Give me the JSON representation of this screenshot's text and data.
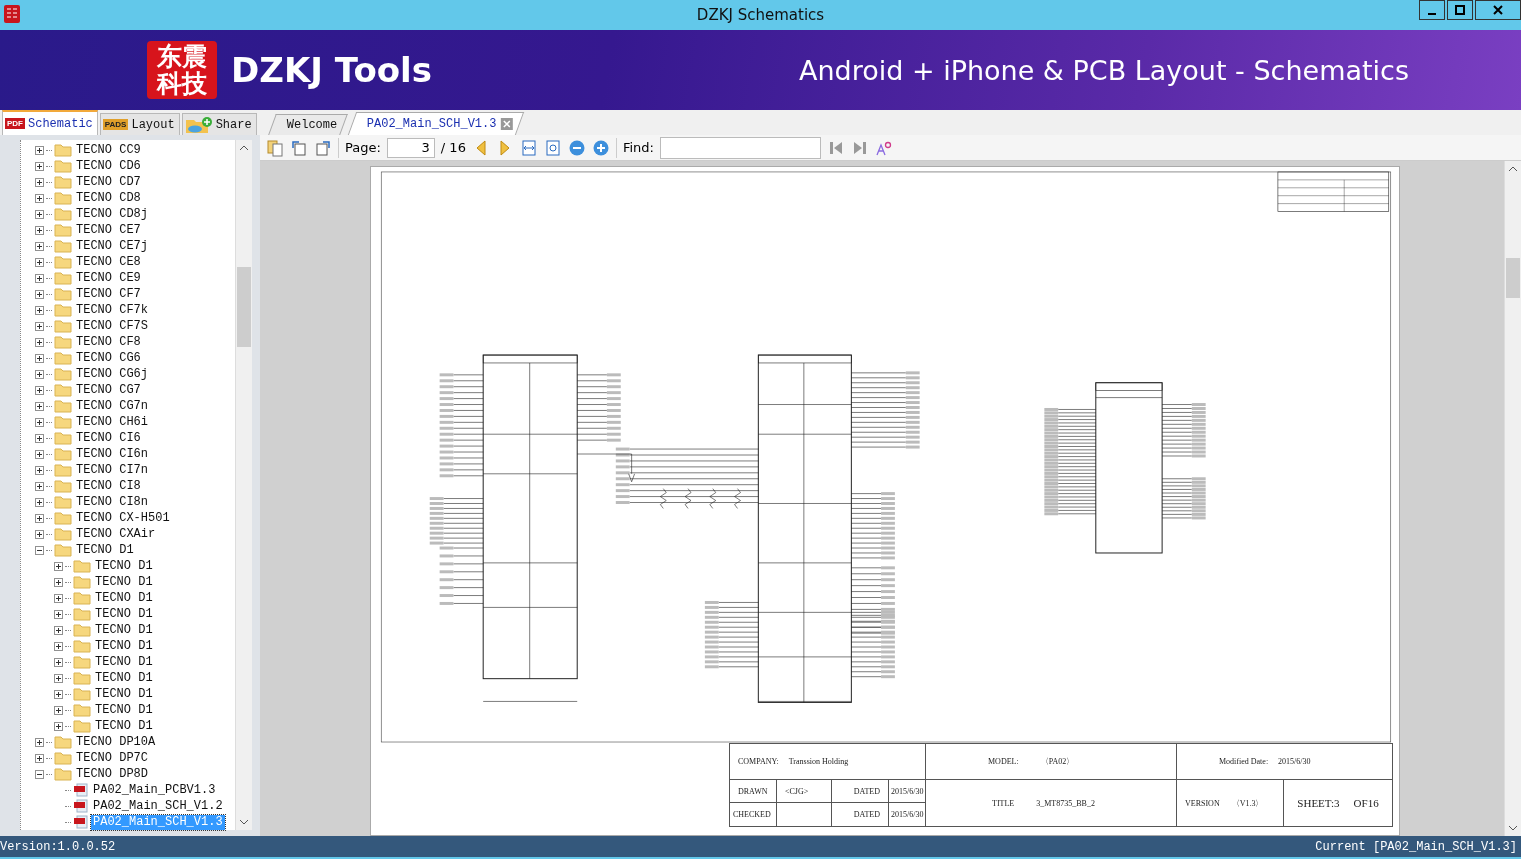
{
  "window": {
    "title": "DZKJ Schematics"
  },
  "banner": {
    "logo_lines": [
      "东震",
      "科技"
    ],
    "title": "DZKJ Tools",
    "tagline": "Android + iPhone & PCB Layout - Schematics"
  },
  "side_tabs": [
    {
      "label": "Schematic",
      "badge": "PDF",
      "selected": true
    },
    {
      "label": "Layout",
      "badge": "PADS",
      "selected": false
    },
    {
      "label": "Share",
      "selected": false
    }
  ],
  "doc_tabs": [
    {
      "label": "Welcome",
      "selected": false,
      "closable": false
    },
    {
      "label": "PA02_Main_SCH_V1.3",
      "selected": true,
      "closable": true
    }
  ],
  "toolbar": {
    "page_label": "Page:",
    "page_value": "3",
    "page_total": "/ 16",
    "find_label": "Find:"
  },
  "tree": [
    {
      "label": "TECNO CC9",
      "kind": "folder",
      "expanded": false,
      "selected": false
    },
    {
      "label": "TECNO CD6",
      "kind": "folder",
      "expanded": false,
      "selected": false
    },
    {
      "label": "TECNO CD7",
      "kind": "folder",
      "expanded": false,
      "selected": false
    },
    {
      "label": "TECNO CD8",
      "kind": "folder",
      "expanded": false,
      "selected": false
    },
    {
      "label": "TECNO CD8j",
      "kind": "folder",
      "expanded": false,
      "selected": false
    },
    {
      "label": "TECNO CE7",
      "kind": "folder",
      "expanded": false,
      "selected": false
    },
    {
      "label": "TECNO CE7j",
      "kind": "folder",
      "expanded": false,
      "selected": false
    },
    {
      "label": "TECNO CE8",
      "kind": "folder",
      "expanded": false,
      "selected": false
    },
    {
      "label": "TECNO CE9",
      "kind": "folder",
      "expanded": false,
      "selected": false
    },
    {
      "label": "TECNO CF7",
      "kind": "folder",
      "expanded": false,
      "selected": false
    },
    {
      "label": "TECNO CF7k",
      "kind": "folder",
      "expanded": false,
      "selected": false
    },
    {
      "label": "TECNO CF7S",
      "kind": "folder",
      "expanded": false,
      "selected": false
    },
    {
      "label": "TECNO CF8",
      "kind": "folder",
      "expanded": false,
      "selected": false
    },
    {
      "label": "TECNO CG6",
      "kind": "folder",
      "expanded": false,
      "selected": false
    },
    {
      "label": "TECNO CG6j",
      "kind": "folder",
      "expanded": false,
      "selected": false
    },
    {
      "label": "TECNO CG7",
      "kind": "folder",
      "expanded": false,
      "selected": false
    },
    {
      "label": "TECNO CG7n",
      "kind": "folder",
      "expanded": false,
      "selected": false
    },
    {
      "label": "TECNO CH6i",
      "kind": "folder",
      "expanded": false,
      "selected": false
    },
    {
      "label": "TECNO CI6",
      "kind": "folder",
      "expanded": false,
      "selected": false
    },
    {
      "label": "TECNO CI6n",
      "kind": "folder",
      "expanded": false,
      "selected": false
    },
    {
      "label": "TECNO CI7n",
      "kind": "folder",
      "expanded": false,
      "selected": false
    },
    {
      "label": "TECNO CI8",
      "kind": "folder",
      "expanded": false,
      "selected": false
    },
    {
      "label": "TECNO CI8n",
      "kind": "folder",
      "expanded": false,
      "selected": false
    },
    {
      "label": "TECNO CX-H501",
      "kind": "folder",
      "expanded": false,
      "selected": false
    },
    {
      "label": "TECNO CXAir",
      "kind": "folder",
      "expanded": false,
      "selected": false
    },
    {
      "label": "TECNO D1",
      "kind": "folder",
      "expanded": true,
      "selected": false,
      "children": [
        {
          "label": "TECNO D1",
          "kind": "folder",
          "expanded": false,
          "selected": false
        },
        {
          "label": "TECNO D1",
          "kind": "folder",
          "expanded": false,
          "selected": false
        },
        {
          "label": "TECNO D1",
          "kind": "folder",
          "expanded": false,
          "selected": false
        },
        {
          "label": "TECNO D1",
          "kind": "folder",
          "expanded": false,
          "selected": false
        },
        {
          "label": "TECNO D1",
          "kind": "folder",
          "expanded": false,
          "selected": false
        },
        {
          "label": "TECNO D1",
          "kind": "folder",
          "expanded": false,
          "selected": false
        },
        {
          "label": "TECNO D1",
          "kind": "folder",
          "expanded": false,
          "selected": false
        },
        {
          "label": "TECNO D1",
          "kind": "folder",
          "expanded": false,
          "selected": false
        },
        {
          "label": "TECNO D1",
          "kind": "folder",
          "expanded": false,
          "selected": false
        },
        {
          "label": "TECNO D1",
          "kind": "folder",
          "expanded": false,
          "selected": false
        },
        {
          "label": "TECNO D1",
          "kind": "folder",
          "expanded": false,
          "selected": false
        }
      ]
    },
    {
      "label": "TECNO DP10A",
      "kind": "folder",
      "expanded": false,
      "selected": false
    },
    {
      "label": "TECNO DP7C",
      "kind": "folder",
      "expanded": false,
      "selected": false
    },
    {
      "label": "TECNO DP8D",
      "kind": "folder",
      "expanded": true,
      "selected": false,
      "children": [
        {
          "label": "PA02_Main_PCBV1.3",
          "kind": "pdf",
          "selected": false
        },
        {
          "label": "PA02_Main_SCH_V1.2",
          "kind": "pdf",
          "selected": false
        },
        {
          "label": "PA02_Main_SCH_V1.3",
          "kind": "pdf",
          "selected": true
        }
      ]
    }
  ],
  "title_block": {
    "company_label": "COMPANY:",
    "company": "Transsion Holding",
    "model_label": "MODEL:",
    "model": "〈PA02〉",
    "modified_label": "Modified Date:",
    "modified": "2015/6/30",
    "drawn_label": "DRAWN",
    "drawn": "<CJG>",
    "dated_label_1": "DATED",
    "dated_1": "2015/6/30",
    "checked_label": "CHECKED",
    "dated_label_2": "DATED",
    "dated_2": "2015/6/30",
    "title_label": "TITLE",
    "title": "3_MT8735_BB_2",
    "version_label": "VERSION",
    "version": "〈V1.3〉",
    "sheet": "SHEET:3",
    "of": "OF16"
  },
  "status_bar": {
    "version": "Version:1.0.0.52",
    "current": "Current [PA02_Main_SCH_V1.3]"
  }
}
